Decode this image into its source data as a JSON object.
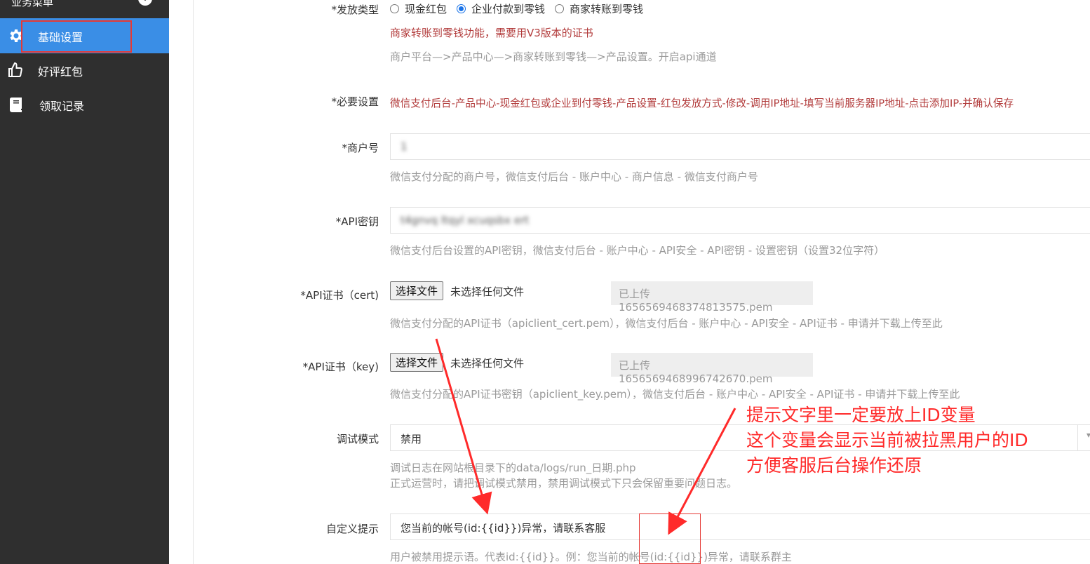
{
  "sidebar": {
    "header_title": "业务菜单",
    "items": [
      {
        "label": "基础设置",
        "icon": "gear-icon",
        "active": true
      },
      {
        "label": "好评红包",
        "icon": "thumbs-up-icon",
        "active": false
      },
      {
        "label": "领取记录",
        "icon": "book-icon",
        "active": false
      }
    ]
  },
  "form": {
    "payout_type": {
      "label": "*发放类型",
      "options": [
        "现金红包",
        "企业付款到零钱",
        "商家转账到零钱"
      ],
      "selected": "企业付款到零钱",
      "warning": "商家转账到零钱功能，需要用V3版本的证书",
      "hint": "商户平台—>产品中心—>商家转账到零钱—>产品设置。开启api通道"
    },
    "required_settings": {
      "label": "*必要设置",
      "text": "微信支付后台-产品中心-现金红包或企业到付零钱-产品设置-红包发放方式-修改-调用IP地址-填写当前服务器IP地址-点击添加IP-并确认保存"
    },
    "merchant_id": {
      "label": "*商户号",
      "value": "1",
      "hint": "微信支付分配的商户号，微信支付后台 - 账户中心 - 商户信息 - 微信支付商户号"
    },
    "api_key": {
      "label": "*API密钥",
      "value": "t4gnvq ltqyl xcuqsbx                    ert",
      "hint": "微信支付后台设置的API密钥，微信支付后台 - 账户中心 - API安全 - API密钥 - 设置密钥（设置32位字符）"
    },
    "api_cert": {
      "label": "*API证书（cert)",
      "button": "选择文件",
      "file_status": "未选择任何文件",
      "uploaded": "已上传 1656569468374813575.pem",
      "hint": "微信支付分配的API证书（apiclient_cert.pem），微信支付后台 - 账户中心 - API安全 - API证书 - 申请并下载上传至此"
    },
    "api_key_cert": {
      "label": "*API证书（key)",
      "button": "选择文件",
      "file_status": "未选择任何文件",
      "uploaded": "已上传 1656569468996742670.pem",
      "hint": "微信支付分配的API证书密钥（apiclient_key.pem），微信支付后台 - 账户中心 - API安全 - API证书 - 申请并下载上传至此"
    },
    "debug_mode": {
      "label": "调试模式",
      "value": "禁用",
      "hint1": "调试日志在网站根目录下的data/logs/run_日期.php",
      "hint2": "正式运营时，请把调试模式禁用，禁用调试模式下只会保留重要问题日志。"
    },
    "custom_tip": {
      "label": "自定义提示",
      "value": "您当前的帐号(id:{{id}})异常，请联系客服",
      "hint": "用户被禁用提示语。代表id:{{id}}。例：您当前的帐号(id:{{id}})异常，请联系群主"
    }
  },
  "annotation": {
    "line1": "提示文字里一定要放上ID变量",
    "line2": "这个变量会显示当前被拉黑用户的ID",
    "line3": "方便客服后台操作还原",
    "color": "#ff2a2a"
  },
  "colors": {
    "sidebar_bg": "#2f2f2f",
    "active_bg": "#3a8ee6",
    "warning": "#b23b3b",
    "hint": "#9a9a9a"
  }
}
